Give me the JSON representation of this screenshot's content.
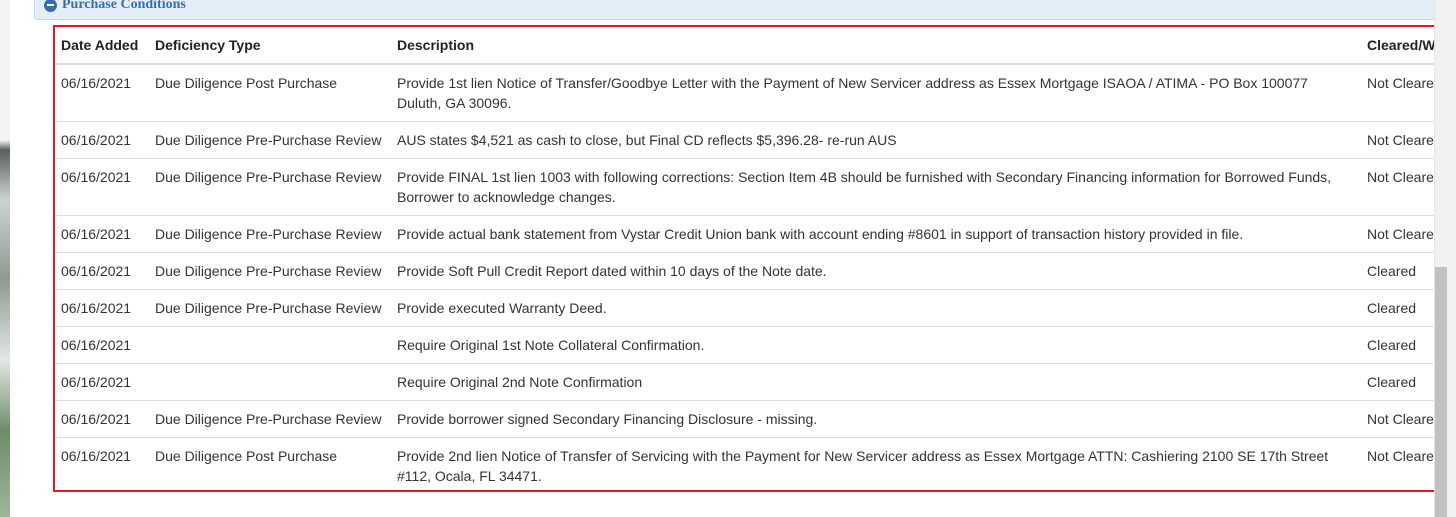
{
  "panel": {
    "title": "Purchase Conditions",
    "icon": "minus-circle-icon",
    "accent_color": "#3a6ea8"
  },
  "table": {
    "columns": [
      "Date Added",
      "Deficiency Type",
      "Description",
      "Cleared/W"
    ],
    "rows": [
      {
        "date": "06/16/2021",
        "type": "Due Diligence Post Purchase",
        "description": "Provide 1st lien Notice of Transfer/Goodbye Letter with the Payment of New Servicer address as Essex Mortgage ISAOA / ATIMA - PO Box 100077 Duluth, GA 30096.",
        "status": "Not Cleare"
      },
      {
        "date": "06/16/2021",
        "type": "Due Diligence Pre-Purchase Review",
        "description": "AUS states $4,521 as cash to close, but Final CD reflects $5,396.28- re-run AUS",
        "status": "Not Cleare"
      },
      {
        "date": "06/16/2021",
        "type": "Due Diligence Pre-Purchase Review",
        "description": "Provide FINAL 1st lien 1003 with following corrections: Section Item 4B should be furnished with Secondary Financing information for Borrowed Funds, Borrower to acknowledge changes.",
        "status": "Not Cleare"
      },
      {
        "date": "06/16/2021",
        "type": "Due Diligence Pre-Purchase Review",
        "description": "Provide actual bank statement from Vystar Credit Union bank with account ending #8601 in support of transaction history provided in file.",
        "status": "Not Cleare"
      },
      {
        "date": "06/16/2021",
        "type": "Due Diligence Pre-Purchase Review",
        "description": "Provide Soft Pull Credit Report dated within 10 days of the Note date.",
        "status": "Cleared"
      },
      {
        "date": "06/16/2021",
        "type": "Due Diligence Pre-Purchase Review",
        "description": "Provide executed Warranty Deed.",
        "status": "Cleared"
      },
      {
        "date": "06/16/2021",
        "type": "",
        "description": "Require Original 1st Note Collateral Confirmation.",
        "status": "Cleared"
      },
      {
        "date": "06/16/2021",
        "type": "",
        "description": "Require Original 2nd Note Confirmation",
        "status": "Cleared"
      },
      {
        "date": "06/16/2021",
        "type": "Due Diligence Pre-Purchase Review",
        "description": "Provide borrower signed Secondary Financing Disclosure - missing.",
        "status": "Not Cleare"
      },
      {
        "date": "06/16/2021",
        "type": "Due Diligence Post Purchase",
        "description": "Provide 2nd lien Notice of Transfer of Servicing with the Payment for New Servicer address as Essex Mortgage ATTN: Cashiering 2100 SE 17th Street #112, Ocala, FL 34471.",
        "status": "Not Cleare"
      }
    ]
  },
  "highlight_color": "#e01b24"
}
